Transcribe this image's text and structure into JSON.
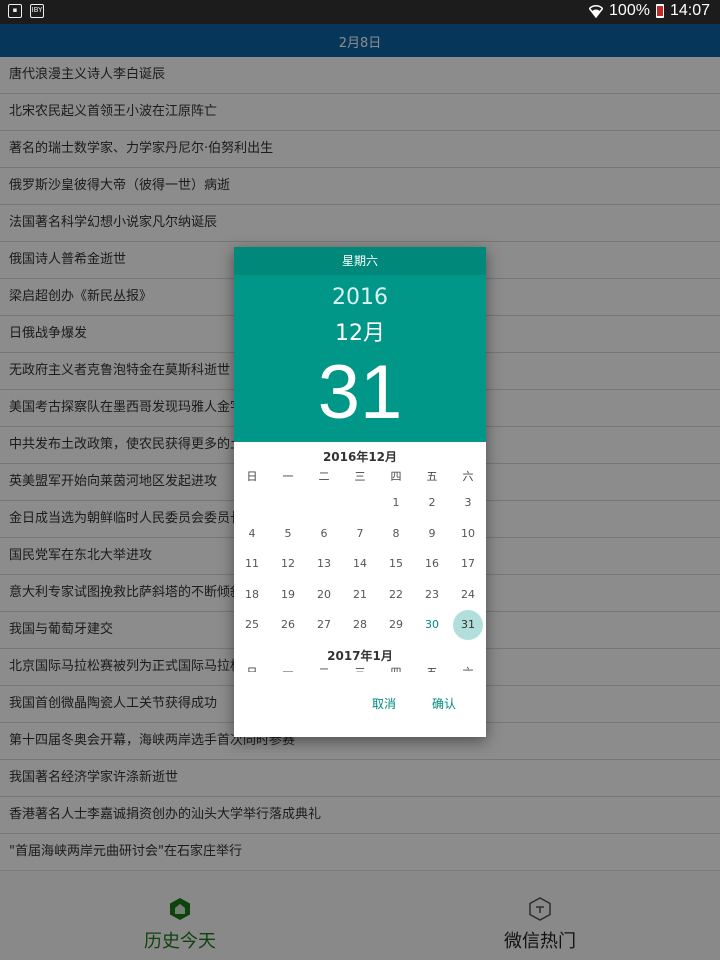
{
  "status_bar": {
    "left_icons": [
      "image-icon",
      "notification-icon"
    ],
    "notification_icon_text": "IBY",
    "battery_percent": "100%",
    "time": "14:07"
  },
  "appbar": {
    "title": "2月8日"
  },
  "events": [
    "唐代浪漫主义诗人李白诞辰",
    "北宋农民起义首领王小波在江原阵亡",
    "著名的瑞士数学家、力学家丹尼尔·伯努利出生",
    "俄罗斯沙皇彼得大帝（彼得一世）病逝",
    "法国著名科学幻想小说家凡尔纳诞辰",
    "俄国诗人普希金逝世",
    "梁启超创办《新民丛报》",
    "日俄战争爆发",
    "无政府主义者克鲁泡特金在莫斯科逝世",
    "美国考古探察队在墨西哥发现玛雅人金字",
    "中共发布土改政策，使农民获得更多的土",
    "英美盟军开始向莱茵河地区发起进攻",
    "金日成当选为朝鲜临时人民委员会委员长",
    "国民党军在东北大举进攻",
    "意大利专家试图挽救比萨斜塔的不断倾斜",
    "我国与葡萄牙建交",
    "北京国际马拉松赛被列为正式国际马拉松",
    "我国首创微晶陶瓷人工关节获得成功",
    "第十四届冬奥会开幕，海峡两岸选手首次同时参赛",
    "我国著名经济学家许涤新逝世",
    "香港著名人士李嘉诚捐资创办的汕头大学举行落成典礼",
    "\"首届海峡两岸元曲研讨会\"在石家庄举行"
  ],
  "bottom_nav": {
    "left_label": "历史今天",
    "right_label": "微信热门"
  },
  "dialog": {
    "weekday": "星期六",
    "year": "2016",
    "month": "12月",
    "day": "31",
    "calendar_title": "2016年12月",
    "week_headers": [
      "日",
      "一",
      "二",
      "三",
      "四",
      "五",
      "六"
    ],
    "weeks": [
      [
        "",
        "",
        "",
        "",
        "1",
        "2",
        "3"
      ],
      [
        "4",
        "5",
        "6",
        "7",
        "8",
        "9",
        "10"
      ],
      [
        "11",
        "12",
        "13",
        "14",
        "15",
        "16",
        "17"
      ],
      [
        "18",
        "19",
        "20",
        "21",
        "22",
        "23",
        "24"
      ],
      [
        "25",
        "26",
        "27",
        "28",
        "29",
        "30",
        "31"
      ]
    ],
    "today": "30",
    "selected": "31",
    "next_month_title": "2017年1月",
    "cancel_label": "取消",
    "ok_label": "确认"
  },
  "colors": {
    "appbar": "#0b64a6",
    "dialog_header": "#009688",
    "accent": "#00897b",
    "nav_active": "#1b7a1b"
  }
}
